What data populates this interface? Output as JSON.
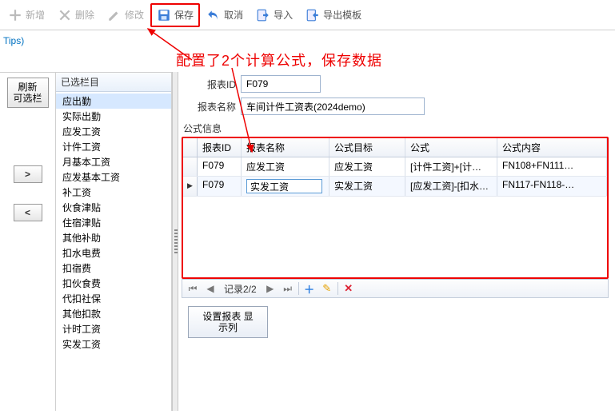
{
  "toolbar": {
    "new": "新增",
    "delete": "删除",
    "edit": "修改",
    "save": "保存",
    "cancel": "取消",
    "import": "导入",
    "export_tpl": "导出模板"
  },
  "tips": "Tips)",
  "annotation": "配置了2个计算公式，保存数据",
  "left": {
    "refresh_btn_line1": "刷新",
    "refresh_btn_line2": "可选栏",
    "move_right": ">",
    "move_left": "<"
  },
  "selected_panel": {
    "title": "已选栏目",
    "items": [
      "应出勤",
      "实际出勤",
      "应发工资",
      "计件工资",
      "月基本工资",
      "应发基本工资",
      "补工资",
      "伙食津贴",
      "住宿津贴",
      "其他补助",
      "扣水电费",
      "扣宿费",
      "扣伙食费",
      "代扣社保",
      "其他扣款",
      "计时工资",
      "实发工资"
    ]
  },
  "form": {
    "report_id_label": "报表ID",
    "report_id_value": "F079",
    "report_name_label": "报表名称",
    "report_name_value": "车间计件工资表(2024demo)"
  },
  "group_title": "公式信息",
  "grid": {
    "headers": {
      "row": "",
      "id": "报表ID",
      "name": "报表名称",
      "target": "公式目标",
      "formula": "公式",
      "content": "公式内容"
    },
    "rows": [
      {
        "id": "F079",
        "name": "应发工资",
        "target": "应发工资",
        "formula": "[计件工资]+[计…",
        "content": "FN108+FN111…",
        "selected": false
      },
      {
        "id": "F079",
        "name": "实发工资",
        "target": "实发工资",
        "formula": "[应发工资]-[扣水…",
        "content": "FN117-FN118-…",
        "selected": true
      }
    ]
  },
  "record_bar": {
    "text": "记录2/2"
  },
  "display_col_btn_line1": "设置报表 显",
  "display_col_btn_line2": "示列"
}
